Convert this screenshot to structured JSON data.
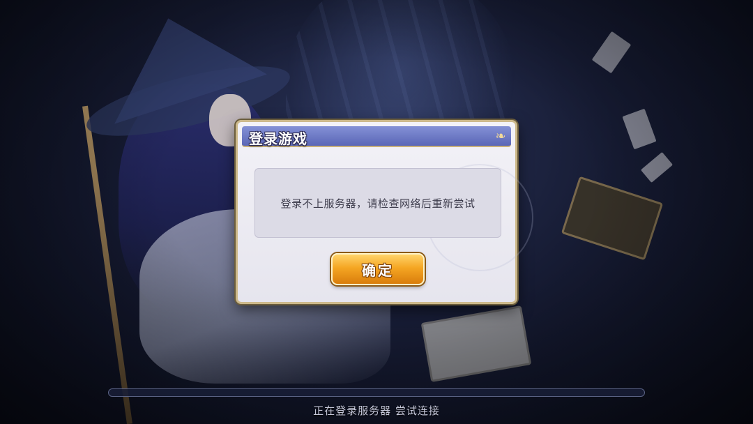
{
  "dialog": {
    "title": "登录游戏",
    "message": "登录不上服务器，请检查网络后重新尝试",
    "confirm_label": "确定"
  },
  "loading": {
    "status": "正在登录服务器 尝试连接",
    "progress": 0.0
  },
  "colors": {
    "header": "#6a76c6",
    "button": "#f5a623",
    "frame_gold": "#cdb98b"
  },
  "icons": {
    "header_ornament": "flourish-icon"
  }
}
